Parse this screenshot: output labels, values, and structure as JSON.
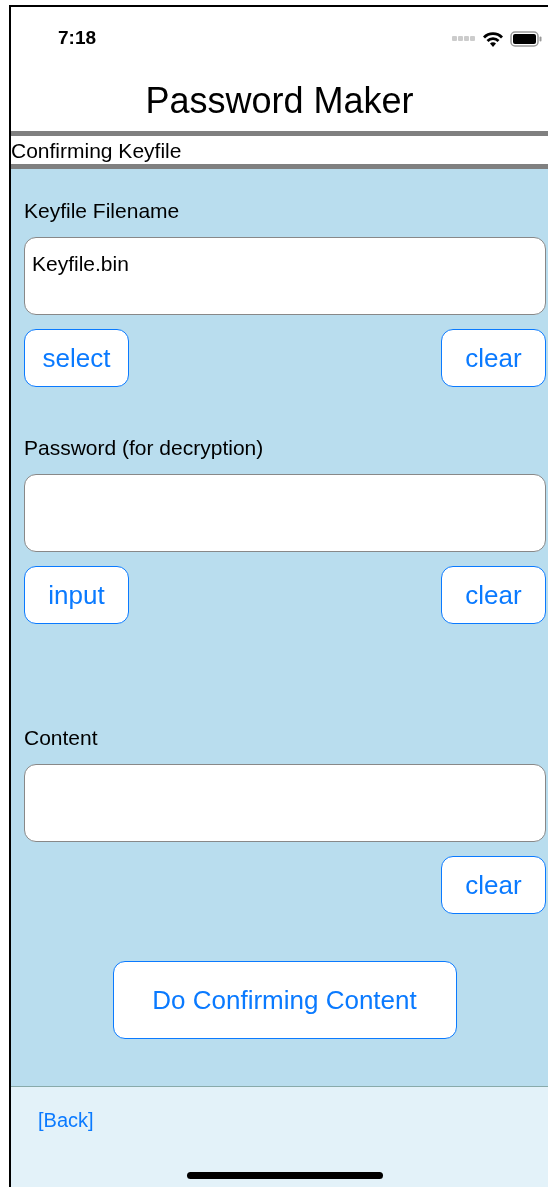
{
  "status_bar": {
    "time": "7:18"
  },
  "title": "Password Maker",
  "subtitle": "Confirming Keyfile",
  "sections": [
    {
      "label": "Keyfile Filename",
      "value": "Keyfile.bin",
      "left_button": "select",
      "right_button": "clear"
    },
    {
      "label": "Password (for decryption)",
      "left_button": "input",
      "right_button": "clear"
    },
    {
      "label": "Content",
      "right_button": "clear"
    }
  ],
  "action_button": "Do Confirming Content",
  "footer": {
    "back_link": "[Back]"
  }
}
